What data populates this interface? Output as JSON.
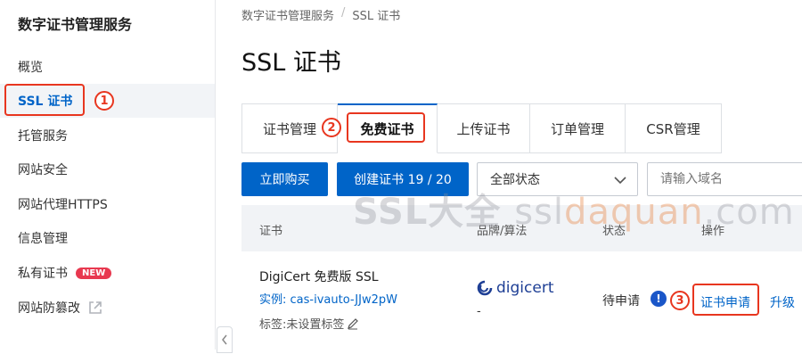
{
  "sidebar": {
    "title": "数字证书管理服务",
    "items": [
      {
        "label": "概览"
      },
      {
        "label": "SSL 证书"
      },
      {
        "label": "托管服务"
      },
      {
        "label": "网站安全"
      },
      {
        "label": "网站代理HTTPS"
      },
      {
        "label": "信息管理"
      },
      {
        "label": "私有证书",
        "badge": "NEW"
      },
      {
        "label": "网站防篡改"
      }
    ]
  },
  "annotations": {
    "one": "1",
    "two": "2",
    "three": "3"
  },
  "breadcrumb": {
    "root": "数字证书管理服务",
    "separator": "/",
    "current": "SSL 证书"
  },
  "page": {
    "title": "SSL 证书"
  },
  "tabs": [
    {
      "label": "证书管理"
    },
    {
      "label": "免费证书"
    },
    {
      "label": "上传证书"
    },
    {
      "label": "订单管理"
    },
    {
      "label": "CSR管理"
    }
  ],
  "toolbar": {
    "buy_label": "立即购买",
    "create_label": "创建证书 19 / 20",
    "status_select": "全部状态",
    "search_placeholder": "请输入域名"
  },
  "table": {
    "headers": [
      "证书",
      "品牌/算法",
      "状态",
      "操作"
    ],
    "rows": [
      {
        "name": "DigiCert 免费版 SSL",
        "instance": "实例: cas-ivauto-JJw2pW",
        "tags": "标签:未设置标签",
        "brand": "digicert",
        "algorithm": "-",
        "status": "待申请",
        "actions": [
          "证书申请",
          "升级"
        ]
      }
    ]
  },
  "watermark": {
    "part1": "SSL大全",
    "part2": "ssl",
    "part3": "daquan",
    "part4": ".com"
  },
  "colors": {
    "accent": "#0064c8",
    "annotation": "#e8361f",
    "badge": "#e8384f"
  }
}
